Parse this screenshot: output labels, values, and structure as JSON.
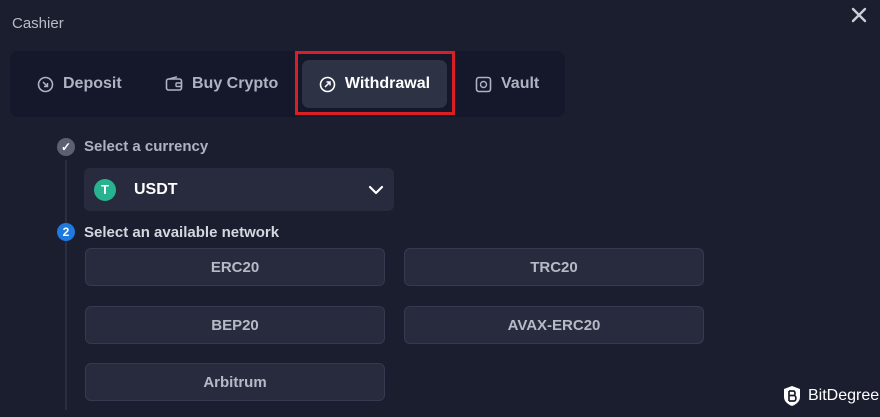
{
  "window": {
    "title": "Cashier",
    "close_icon": "close-icon"
  },
  "tabs": [
    {
      "label": "Deposit",
      "icon": "deposit-icon",
      "active": false
    },
    {
      "label": "Buy Crypto",
      "icon": "wallet-icon",
      "active": false
    },
    {
      "label": "Withdrawal",
      "icon": "withdraw-arrow-icon",
      "active": true
    },
    {
      "label": "Vault",
      "icon": "vault-icon",
      "active": false
    }
  ],
  "annotation": {
    "highlight_color": "#d81f26"
  },
  "steps": {
    "currency": {
      "badge": "✓",
      "label": "Select a currency"
    },
    "network": {
      "badge": "2",
      "label": "Select an available network"
    }
  },
  "currency": {
    "icon_letter": "T",
    "icon_color": "#27b38f",
    "name": "USDT"
  },
  "networks": [
    "ERC20",
    "TRC20",
    "BEP20",
    "AVAX-ERC20",
    "Arbitrum"
  ],
  "watermark": {
    "text": "BitDegree"
  },
  "colors": {
    "background": "#1b1e2e",
    "active_tab": "#2d3245",
    "step_active": "#1f7ae0"
  }
}
